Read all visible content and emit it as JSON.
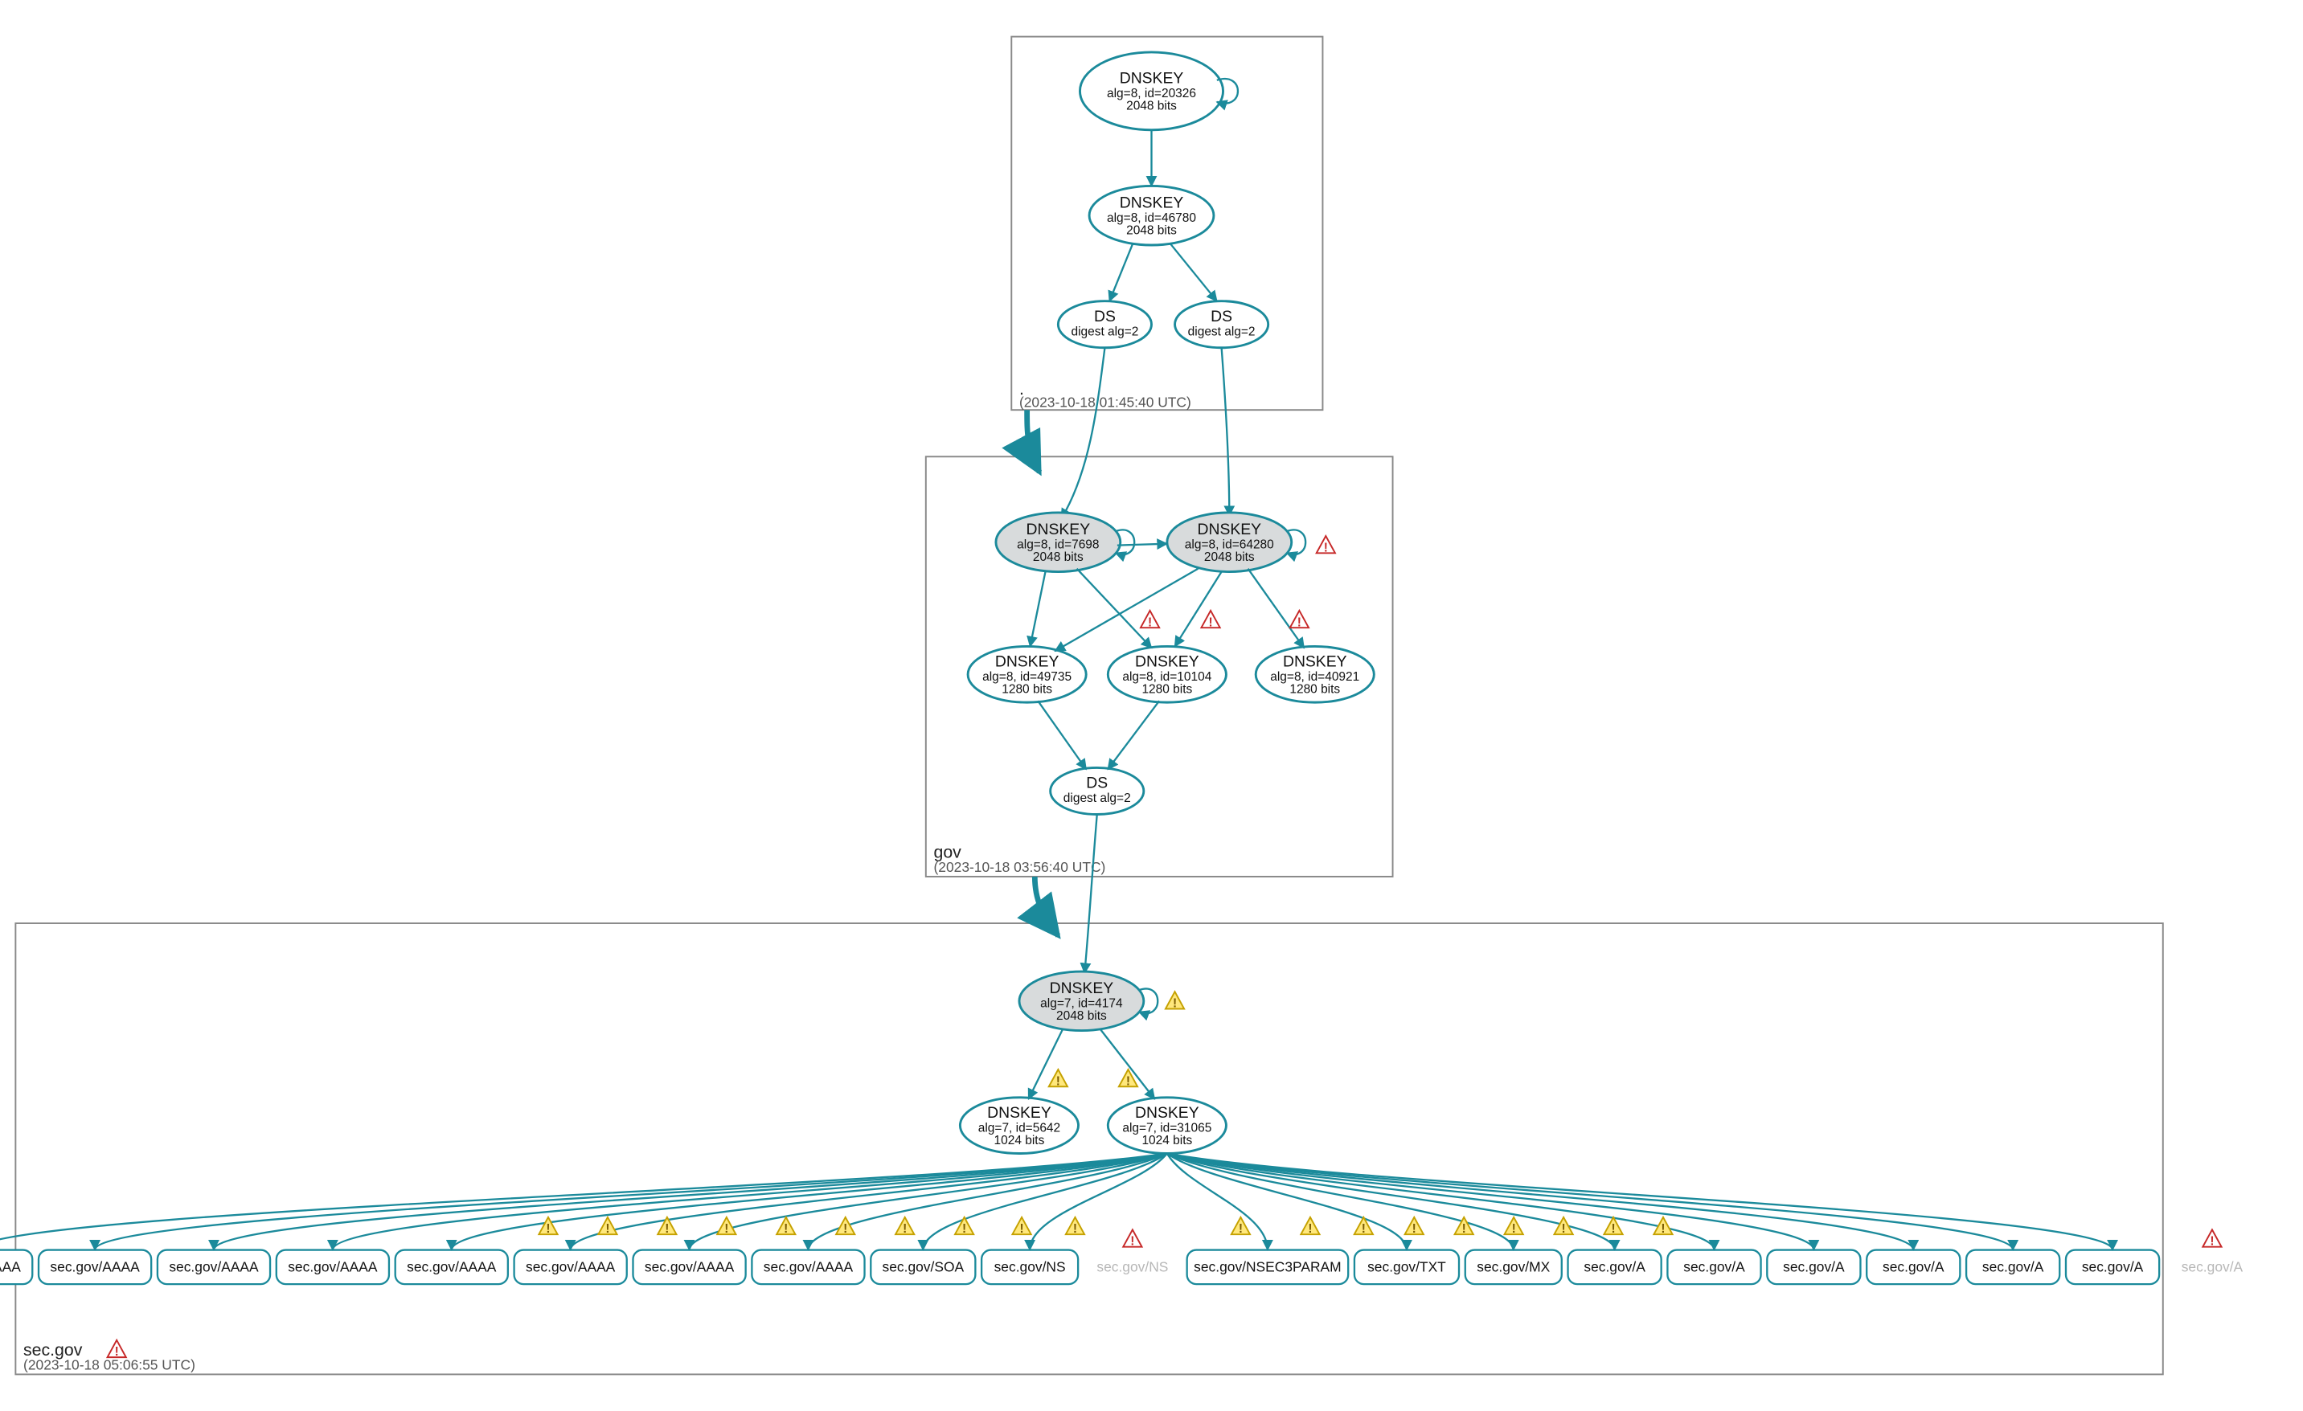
{
  "zones": {
    "root": {
      "label": ".",
      "timestamp": "(2023-10-18 01:45:40 UTC)"
    },
    "gov": {
      "label": "gov",
      "timestamp": "(2023-10-18 03:56:40 UTC)"
    },
    "sec": {
      "label": "sec.gov",
      "timestamp": "(2023-10-18 05:06:55 UTC)"
    }
  },
  "nodes": {
    "root_ksk": {
      "title": "DNSKEY",
      "l2": "alg=8, id=20326",
      "l3": "2048 bits"
    },
    "root_zsk": {
      "title": "DNSKEY",
      "l2": "alg=8, id=46780",
      "l3": "2048 bits"
    },
    "root_ds1": {
      "title": "DS",
      "l2": "digest alg=2",
      "l3": ""
    },
    "root_ds2": {
      "title": "DS",
      "l2": "digest alg=2",
      "l3": ""
    },
    "gov_ksk1": {
      "title": "DNSKEY",
      "l2": "alg=8, id=7698",
      "l3": "2048 bits"
    },
    "gov_ksk2": {
      "title": "DNSKEY",
      "l2": "alg=8, id=64280",
      "l3": "2048 bits"
    },
    "gov_zsk1": {
      "title": "DNSKEY",
      "l2": "alg=8, id=49735",
      "l3": "1280 bits"
    },
    "gov_zsk2": {
      "title": "DNSKEY",
      "l2": "alg=8, id=10104",
      "l3": "1280 bits"
    },
    "gov_zsk3": {
      "title": "DNSKEY",
      "l2": "alg=8, id=40921",
      "l3": "1280 bits"
    },
    "gov_ds": {
      "title": "DS",
      "l2": "digest alg=2",
      "l3": ""
    },
    "sec_ksk": {
      "title": "DNSKEY",
      "l2": "alg=7, id=4174",
      "l3": "2048 bits"
    },
    "sec_zsk1": {
      "title": "DNSKEY",
      "l2": "alg=7, id=5642",
      "l3": "1024 bits"
    },
    "sec_zsk2": {
      "title": "DNSKEY",
      "l2": "alg=7, id=31065",
      "l3": "1024 bits"
    }
  },
  "rrsets": [
    {
      "label": "sec.gov/AAAA"
    },
    {
      "label": "sec.gov/AAAA"
    },
    {
      "label": "sec.gov/AAAA"
    },
    {
      "label": "sec.gov/AAAA"
    },
    {
      "label": "sec.gov/AAAA"
    },
    {
      "label": "sec.gov/AAAA"
    },
    {
      "label": "sec.gov/AAAA"
    },
    {
      "label": "sec.gov/AAAA"
    },
    {
      "label": "sec.gov/SOA"
    },
    {
      "label": "sec.gov/NS"
    },
    {
      "label": "sec.gov/NS",
      "dim": true,
      "warn": "red"
    },
    {
      "label": "sec.gov/NSEC3PARAM"
    },
    {
      "label": "sec.gov/TXT"
    },
    {
      "label": "sec.gov/MX"
    },
    {
      "label": "sec.gov/A"
    },
    {
      "label": "sec.gov/A"
    },
    {
      "label": "sec.gov/A"
    },
    {
      "label": "sec.gov/A"
    },
    {
      "label": "sec.gov/A"
    },
    {
      "label": "sec.gov/A"
    },
    {
      "label": "sec.gov/A",
      "dim": true,
      "warn": "red"
    }
  ],
  "colors": {
    "accent": "#1b8a9b",
    "key_fill": "#d8dbdc"
  }
}
